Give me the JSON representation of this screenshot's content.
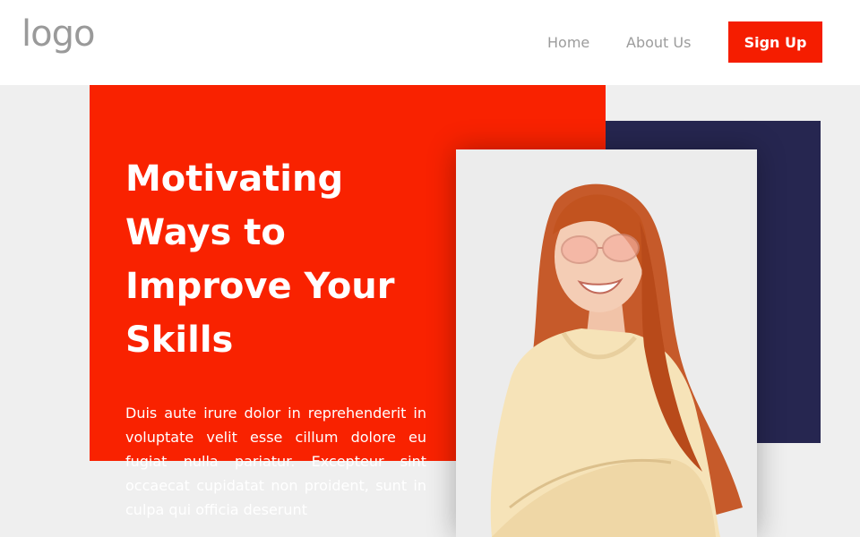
{
  "header": {
    "logo": "logo",
    "nav": [
      {
        "label": "Home"
      },
      {
        "label": "About Us"
      }
    ],
    "signup_label": "Sign Up"
  },
  "hero": {
    "headline": "Motivating Ways to Improve Your Skills",
    "body": "Duis aute irure dolor in reprehenderit in voluptate velit esse cillum dolore eu fugiat nulla pariatur. Excepteur sint occaecat cupidatat non proident, sunt in culpa qui officia deserunt"
  },
  "colors": {
    "accent": "#f92200",
    "navy": "#262650",
    "background": "#efefef"
  }
}
